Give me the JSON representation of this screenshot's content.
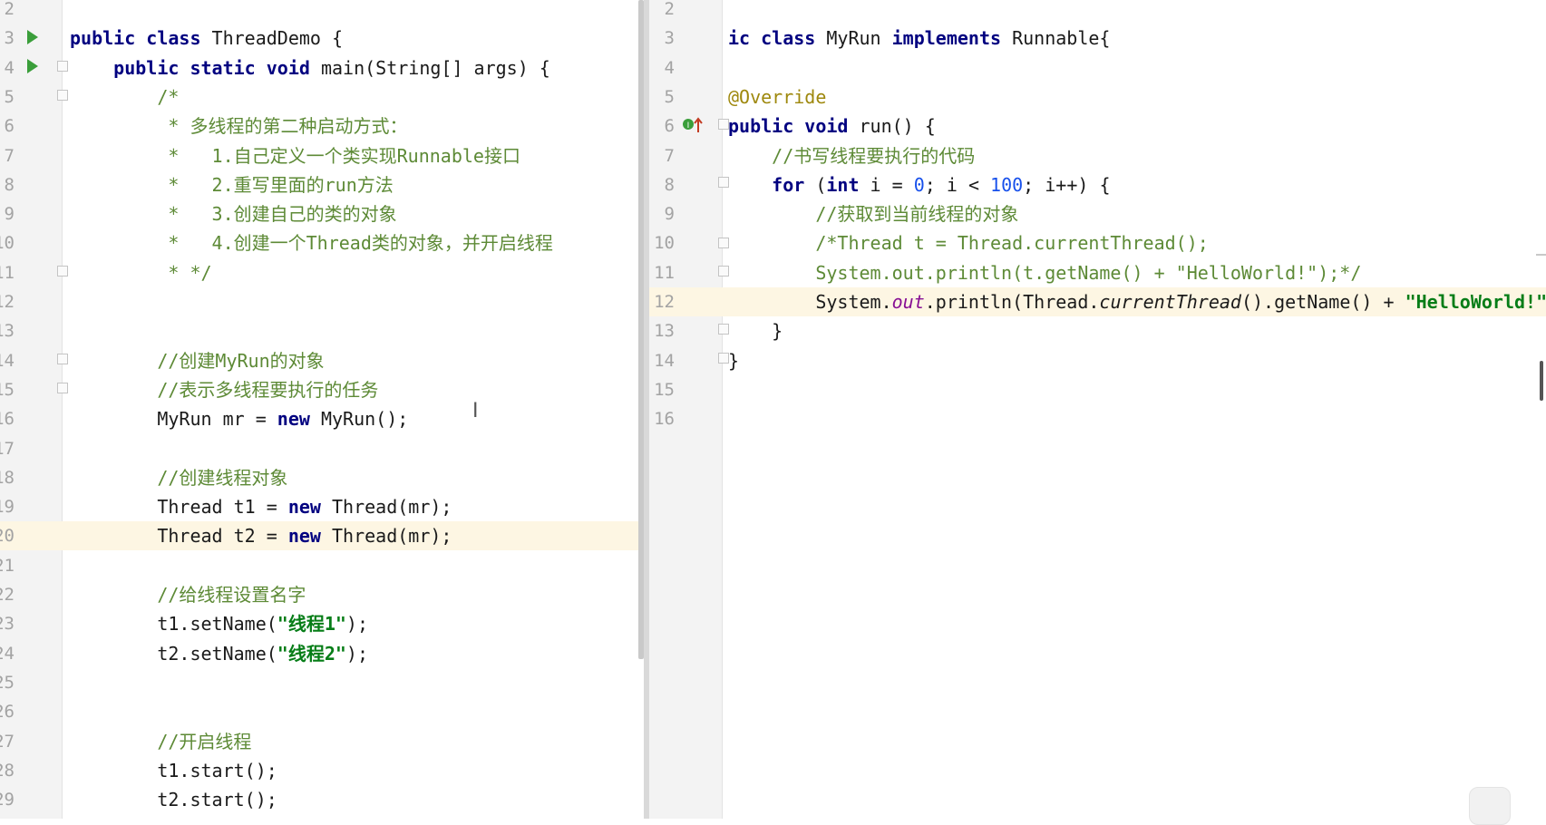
{
  "left_editor": {
    "lines": [
      {
        "n": "2",
        "html": ""
      },
      {
        "n": "3",
        "html": "<span class=\"kw\">public class</span> ThreadDemo {"
      },
      {
        "n": "4",
        "html": "    <span class=\"kw\">public static void</span> main(String[] args) {"
      },
      {
        "n": "5",
        "html": "        <span class=\"cm\">/*</span>"
      },
      {
        "n": "6",
        "html": "         <span class=\"cm\">* <span class=\"cn\">多线程的第二种启动方式：</span></span>"
      },
      {
        "n": "7",
        "html": "         <span class=\"cm\">*   1.<span class=\"cn\">自己定义一个类实现</span>Runnable<span class=\"cn\">接口</span></span>"
      },
      {
        "n": "8",
        "html": "         <span class=\"cm\">*   2.<span class=\"cn\">重写里面的</span>run<span class=\"cn\">方法</span></span>"
      },
      {
        "n": "9",
        "html": "         <span class=\"cm\">*   3.<span class=\"cn\">创建自己的类的对象</span></span>"
      },
      {
        "n": "10",
        "html": "         <span class=\"cm\">*   4.<span class=\"cn\">创建一个</span>Thread<span class=\"cn\">类的对象，并开启线程</span></span>"
      },
      {
        "n": "11",
        "html": "         <span class=\"cm\">* */</span>"
      },
      {
        "n": "12",
        "html": ""
      },
      {
        "n": "13",
        "html": ""
      },
      {
        "n": "14",
        "html": "        <span class=\"cm\">//<span class=\"cn\">创建</span>MyRun<span class=\"cn\">的对象</span></span>"
      },
      {
        "n": "15",
        "html": "        <span class=\"cm\">//<span class=\"cn\">表示多线程要执行的任务</span></span>"
      },
      {
        "n": "16",
        "html": "        MyRun mr = <span class=\"kw\">new</span> MyRun();"
      },
      {
        "n": "17",
        "html": ""
      },
      {
        "n": "18",
        "html": "        <span class=\"cm\">//<span class=\"cn\">创建线程对象</span></span>"
      },
      {
        "n": "19",
        "html": "        Thread t1 = <span class=\"kw\">new</span> Thread(mr);"
      },
      {
        "n": "20",
        "html": "        Thread t2 = <span class=\"kw\">new</span> Thread(mr);",
        "current": true
      },
      {
        "n": "21",
        "html": ""
      },
      {
        "n": "22",
        "html": "        <span class=\"cm\">//<span class=\"cn\">给线程设置名字</span></span>"
      },
      {
        "n": "23",
        "html": "        t1.setName(<span class=\"st\">\"<span class=\"cn\">线程</span>1\"</span>);"
      },
      {
        "n": "24",
        "html": "        t2.setName(<span class=\"st\">\"<span class=\"cn\">线程</span>2\"</span>);"
      },
      {
        "n": "25",
        "html": ""
      },
      {
        "n": "26",
        "html": ""
      },
      {
        "n": "27",
        "html": "        <span class=\"cm\">//<span class=\"cn\">开启线程</span></span>"
      },
      {
        "n": "28",
        "html": "        t1.start();"
      },
      {
        "n": "29",
        "html": "        t2.start();"
      }
    ],
    "caret_glyph": "I"
  },
  "right_editor": {
    "lines": [
      {
        "n": "2",
        "html": ""
      },
      {
        "n": "3",
        "html": "<span class=\"kw\">ic class</span> MyRun <span class=\"kw\">implements</span> Runnable{"
      },
      {
        "n": "4",
        "html": ""
      },
      {
        "n": "5",
        "html": "<span class=\"an\">@Override</span>"
      },
      {
        "n": "6",
        "html": "<span class=\"kw\">public void</span> run() {"
      },
      {
        "n": "7",
        "html": "    <span class=\"cm\">//<span class=\"cn\">书写线程要执行的代码</span></span>"
      },
      {
        "n": "8",
        "html": "    <span class=\"kw\">for</span> (<span class=\"kw\">int</span> i = <span style=\"color:#1750eb\">0</span>; i &lt; <span style=\"color:#1750eb\">100</span>; i++) {"
      },
      {
        "n": "9",
        "html": "        <span class=\"cm\">//<span class=\"cn\">获取到当前线程的对象</span></span>"
      },
      {
        "n": "10",
        "html": "        <span class=\"cm\">/*Thread t = Thread.currentThread();</span>"
      },
      {
        "n": "11",
        "html": "        <span class=\"cm\">System.out.println(t.getName() + \"HelloWorld!\");*/</span>"
      },
      {
        "n": "12",
        "html": "        System.<span class=\"fld\">out</span>.println(Thread.<span class=\"it\">currentThread</span>().getName() + <span class=\"st\">\"HelloWorld!\"</span>);",
        "current": true
      },
      {
        "n": "13",
        "html": "    }"
      },
      {
        "n": "14",
        "html": "}"
      },
      {
        "n": "15",
        "html": ""
      },
      {
        "n": "16",
        "html": ""
      }
    ]
  },
  "colors": {
    "keyword": "#000080",
    "comment": "#5d8a36",
    "string": "#067d17",
    "annotation": "#9e880d",
    "current_line": "#fdf6e3",
    "gutter": "#f3f3f3"
  }
}
